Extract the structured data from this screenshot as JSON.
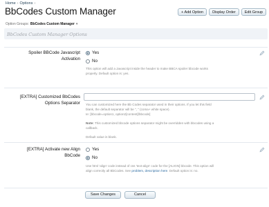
{
  "breadcrumb": {
    "items": [
      "Home",
      "Options"
    ]
  },
  "page": {
    "title": "BbCodes Custom Manager"
  },
  "toolbar": {
    "buttons": [
      "+ Add Option",
      "Display Order",
      "Edit Group"
    ]
  },
  "option_groups": {
    "label": "Option Groups:",
    "value": "BbCodes Custom Manager"
  },
  "subtitle": "BbCodes Custom Manager Options",
  "options": [
    {
      "label_line1": "Spoiler BBCode Javascript",
      "label_line2": "Activation",
      "radios": [
        {
          "label": "Yes",
          "checked": true
        },
        {
          "label": "No",
          "checked": false
        }
      ],
      "description_line1": "This option will add a Javascript inside the header to make BBCA spoiler bbcode works",
      "description_line2": "properly. Default option is: yes."
    },
    {
      "label_line1": "[EXTRA] Customized BbCodes",
      "label_line2": "Options Separator",
      "input_value": "",
      "description_line1": "You can customized here the Bb Codes separator used in their options. If you let this field",
      "description_line2": "blank, the default separator will be \", \" (coma+ white space).",
      "description_line3": "Ie: [bbcode=option1, option2]content[/bbcode]",
      "note_label": "Note:",
      "note_text": "This customized bbcode options separator might be overridden with bbcodes using a",
      "note_text2": "callback.",
      "default_text": "Default value is blank."
    },
    {
      "label_line1": "[EXTRA] Activate new Align",
      "label_line2": "BbCode",
      "radios": [
        {
          "label": "Yes",
          "checked": false
        },
        {
          "label": "No",
          "checked": true
        }
      ],
      "description_line1": "Use html 'align' code instead of css 'text-align' code for the [ALIGN] bbcode. This option will",
      "description_line2_pre": "align correctly all BbCodes. See",
      "description_link": "problem, description here",
      "description_line2_post": ". Default option is: no."
    }
  ],
  "actions": {
    "save": "Save Changes",
    "cancel": "Cancel"
  },
  "colors": {
    "accent": "#2b485c",
    "button_border": "#a5b9c7",
    "subtitle_bg": "#f0f3f7"
  },
  "icons": {
    "edit": "pencil-edit-icon"
  }
}
